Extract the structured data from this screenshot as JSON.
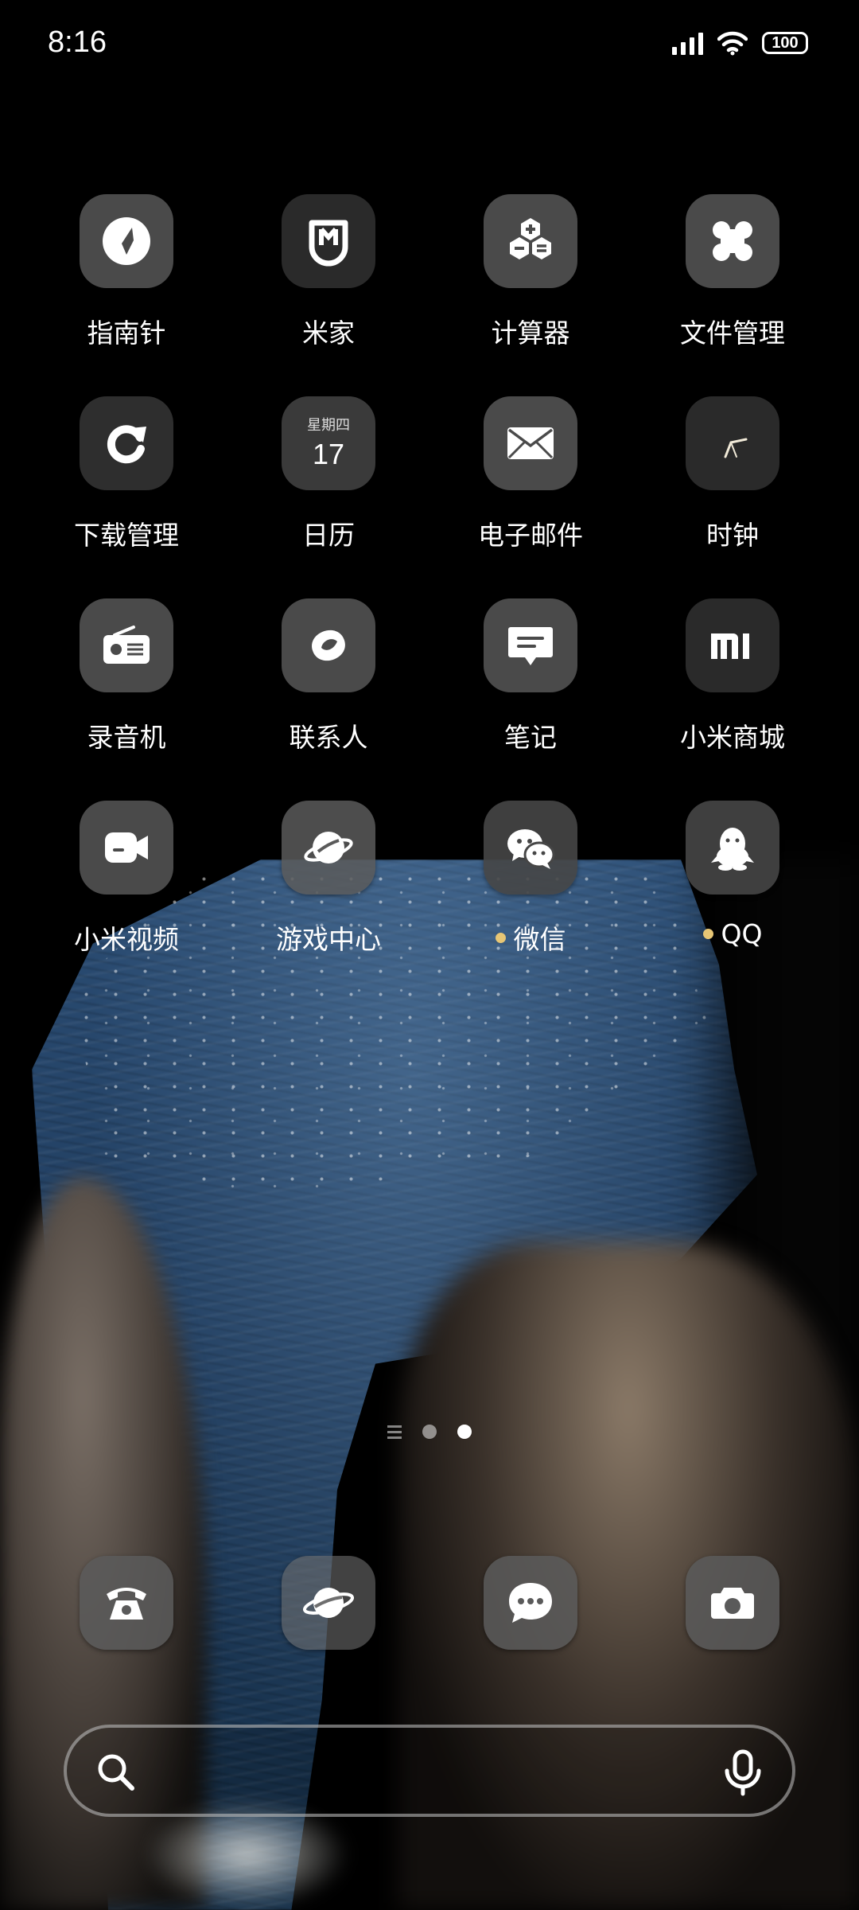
{
  "status_bar": {
    "time": "8:16",
    "battery": "100",
    "icons": [
      "signal-icon",
      "wifi-icon",
      "battery-icon"
    ]
  },
  "apps": [
    {
      "label": "指南针",
      "icon": "compass-icon"
    },
    {
      "label": "米家",
      "icon": "mijia-icon"
    },
    {
      "label": "计算器",
      "icon": "calculator-icon"
    },
    {
      "label": "文件管理",
      "icon": "file-manager-icon"
    },
    {
      "label": "下载管理",
      "icon": "download-manager-icon"
    },
    {
      "label": "日历",
      "icon": "calendar-icon",
      "weekday": "星期四",
      "day": "17"
    },
    {
      "label": "电子邮件",
      "icon": "email-icon"
    },
    {
      "label": "时钟",
      "icon": "clock-icon"
    },
    {
      "label": "录音机",
      "icon": "recorder-icon"
    },
    {
      "label": "联系人",
      "icon": "contacts-icon"
    },
    {
      "label": "笔记",
      "icon": "notes-icon"
    },
    {
      "label": "小米商城",
      "icon": "mi-store-icon"
    },
    {
      "label": "小米视频",
      "icon": "mi-video-icon"
    },
    {
      "label": "游戏中心",
      "icon": "game-center-icon"
    },
    {
      "label": "微信",
      "icon": "wechat-icon",
      "notification": true
    },
    {
      "label": "QQ",
      "icon": "qq-icon",
      "notification": true
    }
  ],
  "page_indicator": {
    "pages": 2,
    "active": 2
  },
  "dock": [
    {
      "icon": "phone-icon"
    },
    {
      "icon": "browser-icon"
    },
    {
      "icon": "messages-icon"
    },
    {
      "icon": "camera-icon"
    }
  ],
  "search_bar": {
    "icons": [
      "search-icon",
      "mic-icon"
    ]
  },
  "colors": {
    "icon_bg": "#4a4a4a",
    "notification_dot": "#e7c675"
  }
}
